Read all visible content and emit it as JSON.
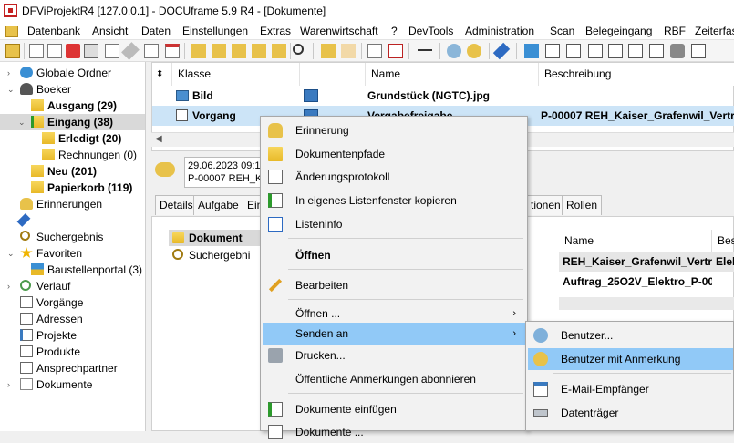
{
  "window": {
    "title": "DFViProjektR4 [127.0.0.1] - DOCUframe 5.9 R4 - [Dokumente]"
  },
  "menu": [
    "Datenbank",
    "Ansicht",
    "Daten",
    "Einstellungen",
    "Extras",
    "Warenwirtschaft",
    "?",
    "DevTools",
    "Administration",
    "Scan",
    "Belegeingang",
    "RBF",
    "Zeiterfas"
  ],
  "tree": [
    {
      "label": "Globale Ordner",
      "icon": "globe-icon"
    },
    {
      "label": "Boeker",
      "icon": "user-icon"
    },
    {
      "label": "Ausgang (29)",
      "icon": "folder-out-icon"
    },
    {
      "label": "Eingang (38)",
      "icon": "folder-in-icon"
    },
    {
      "label": "Erledigt (20)",
      "icon": "folder-icon"
    },
    {
      "label": "Rechnungen (0)",
      "icon": "folder-icon"
    },
    {
      "label": "Neu (201)",
      "icon": "folder-icon"
    },
    {
      "label": "Papierkorb (119)",
      "icon": "trash-icon"
    },
    {
      "label": "Erinnerungen",
      "icon": "bell-icon"
    },
    {
      "label": "",
      "icon": "pin-icon"
    },
    {
      "label": "Suchergebnis",
      "icon": "search-icon"
    },
    {
      "label": "Favoriten",
      "icon": "star-icon"
    },
    {
      "label": "Baustellenportal (3)",
      "icon": "portal-icon"
    },
    {
      "label": "Verlauf",
      "icon": "history-icon"
    },
    {
      "label": "Vorgänge",
      "icon": "process-icon"
    },
    {
      "label": "Adressen",
      "icon": "address-icon"
    },
    {
      "label": "Projekte",
      "icon": "project-icon"
    },
    {
      "label": "Produkte",
      "icon": "product-icon"
    },
    {
      "label": "Ansprechpartner",
      "icon": "contact-icon"
    },
    {
      "label": "Dokumente",
      "icon": "document-icon"
    }
  ],
  "grid": {
    "columns": [
      "Klasse",
      "Name",
      "Beschreibung"
    ],
    "rows": [
      {
        "klasse": "Bild",
        "name": "Grundstück (NGTC).jpg",
        "beschreibung": ""
      },
      {
        "klasse": "Vorgang",
        "name": "Vergabefreigabe",
        "beschreibung": "P-00007 REH_Kaiser_Grafenwil_Vertra"
      }
    ]
  },
  "info": {
    "date": "29.06.2023 09:1",
    "ref": "P-00007 REH_K"
  },
  "tabs": [
    "Details",
    "Aufgabe",
    "Ein",
    "tionen",
    "Rollen"
  ],
  "lower": {
    "tree": [
      "Dokument",
      "Suchergebni"
    ],
    "columns": [
      "Name",
      "Bes"
    ],
    "rows": [
      {
        "name": "REH_Kaiser_Grafenwil_Vertra",
        "extra": "Elek"
      },
      {
        "name": "Auftrag_25O2V_Elektro_P-00",
        "extra": ""
      }
    ]
  },
  "context_menu": [
    "Erinnerung",
    "Dokumentenpfade",
    "Änderungsprotokoll",
    "In eigenes Listenfenster kopieren",
    "Listeninfo",
    "Öffnen",
    "Bearbeiten",
    "Öffnen ...",
    "Senden an",
    "Drucken...",
    "Öffentliche Anmerkungen abonnieren",
    "Dokumente einfügen",
    "Dokumente ..."
  ],
  "submenu": [
    "Benutzer...",
    "Benutzer mit Anmerkung",
    "E-Mail-Empfänger",
    "Datenträger"
  ],
  "colors": {
    "selection": "#91c9f7",
    "row_selected": "#cce4f7",
    "folder": "#f0c540"
  }
}
